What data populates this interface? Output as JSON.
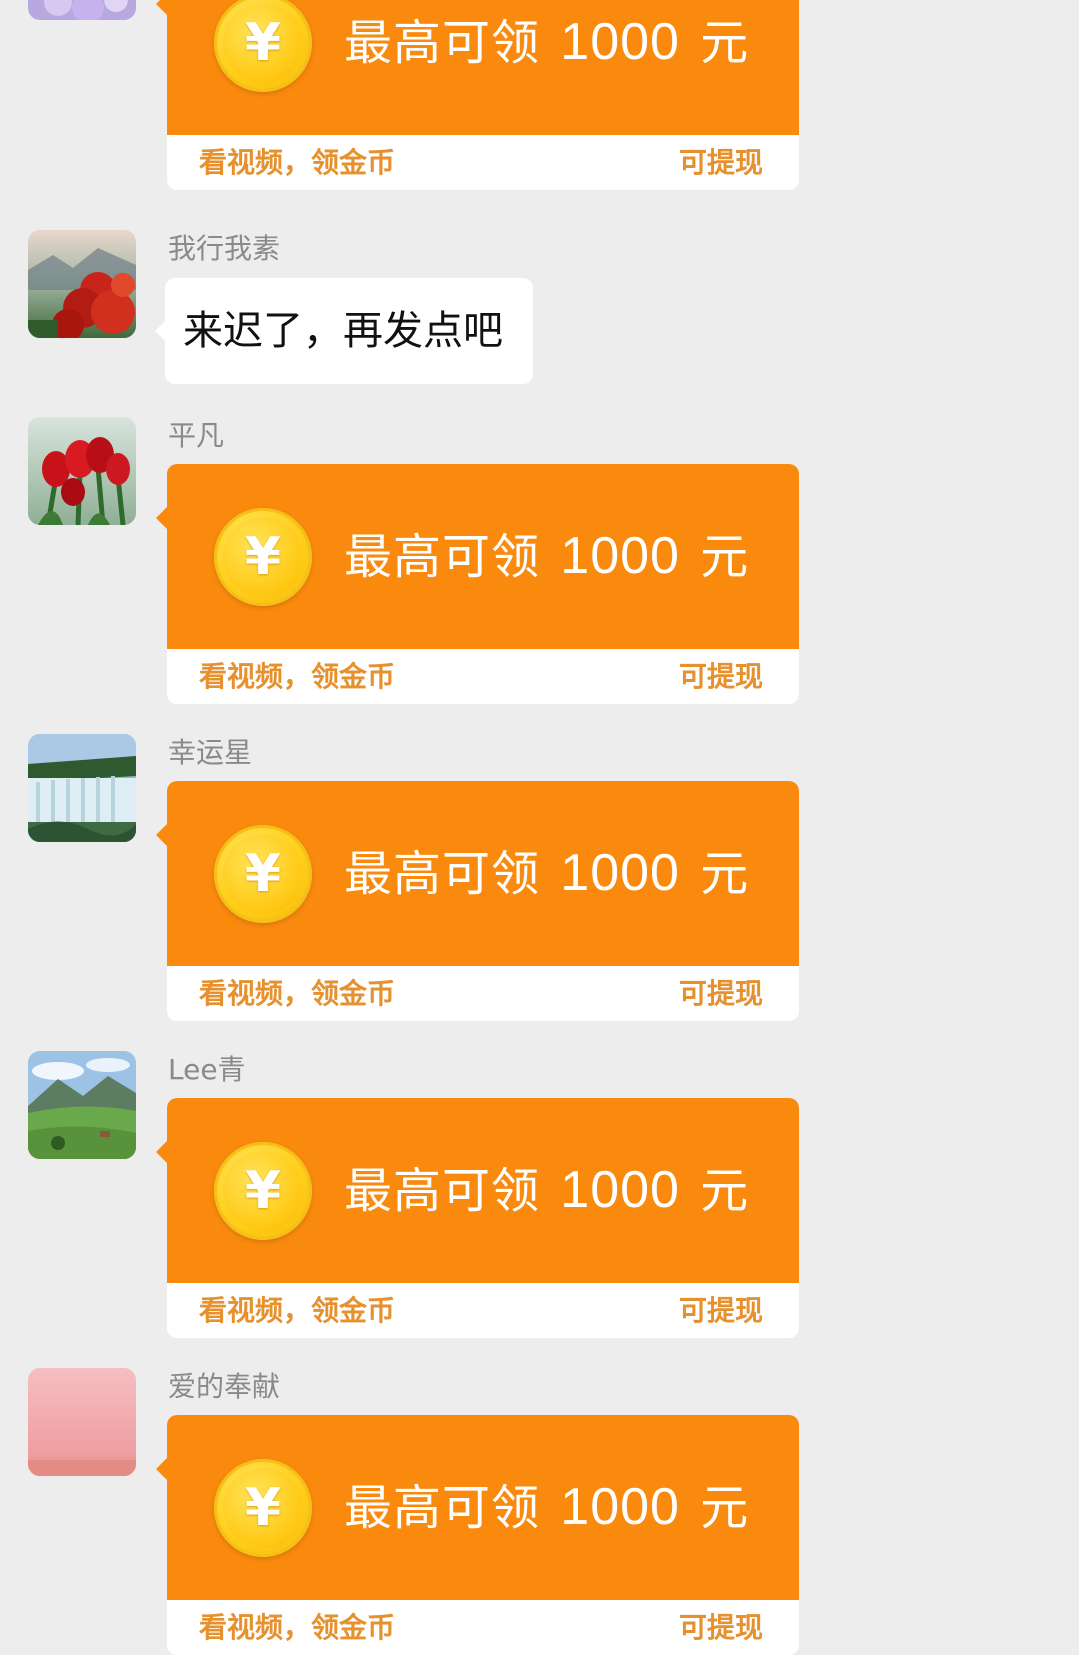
{
  "colors": {
    "background": "#ededed",
    "card_orange": "#fa8a0e",
    "card_footer_text": "#e6902e",
    "sender_gray": "#8a8a8a"
  },
  "messages": [
    {
      "type": "reward_card",
      "sender": "",
      "avatar_icon": "purple-flowers-avatar",
      "card": {
        "coin_symbol": "¥",
        "title_prefix": "最高可领",
        "amount": "1000",
        "unit": "元",
        "footer_left": "看视频，领金币",
        "footer_right": "可提现"
      }
    },
    {
      "type": "text",
      "sender": "我行我素",
      "avatar_icon": "red-flowers-landscape-avatar",
      "text": "来迟了，再发点吧"
    },
    {
      "type": "reward_card",
      "sender": "平凡",
      "avatar_icon": "red-tulips-avatar",
      "card": {
        "coin_symbol": "¥",
        "title_prefix": "最高可领",
        "amount": "1000",
        "unit": "元",
        "footer_left": "看视频，领金币",
        "footer_right": "可提现"
      }
    },
    {
      "type": "reward_card",
      "sender": "幸运星",
      "avatar_icon": "waterfall-avatar",
      "card": {
        "coin_symbol": "¥",
        "title_prefix": "最高可领",
        "amount": "1000",
        "unit": "元",
        "footer_left": "看视频，领金币",
        "footer_right": "可提现"
      }
    },
    {
      "type": "reward_card",
      "sender": "Lee青",
      "avatar_icon": "mountain-valley-avatar",
      "card": {
        "coin_symbol": "¥",
        "title_prefix": "最高可领",
        "amount": "1000",
        "unit": "元",
        "footer_left": "看视频，领金币",
        "footer_right": "可提现"
      }
    },
    {
      "type": "reward_card",
      "sender": "爱的奉献",
      "avatar_icon": "pink-sky-avatar",
      "card": {
        "coin_symbol": "¥",
        "title_prefix": "最高可领",
        "amount": "1000",
        "unit": "元",
        "footer_left": "看视频，领金币",
        "footer_right": "可提现"
      }
    }
  ]
}
